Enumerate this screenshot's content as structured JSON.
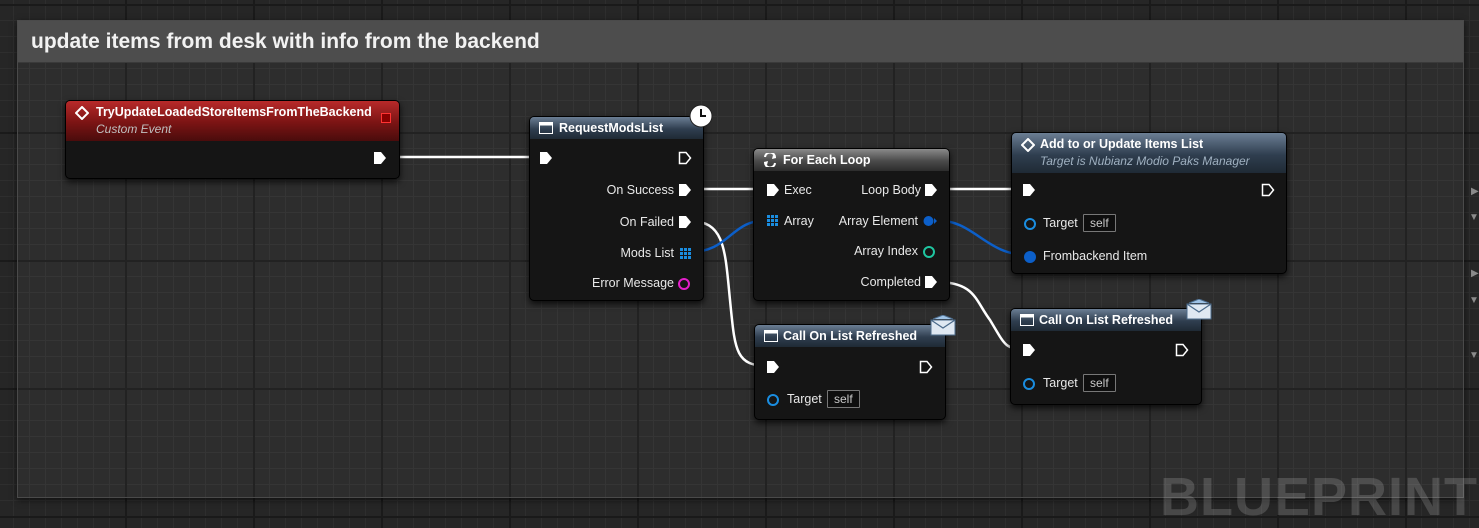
{
  "comment": {
    "title": "update items from desk with info from the backend"
  },
  "watermark": "BLUEPRINT",
  "event_node": {
    "title": "TryUpdateLoadedStoreItemsFromTheBackend",
    "subtitle": "Custom Event"
  },
  "request_node": {
    "title": "RequestModsList",
    "outputs": [
      "On Success",
      "On Failed",
      "Mods List",
      "Error Message"
    ]
  },
  "loop_node": {
    "title": "For Each Loop",
    "inputs": [
      "Exec",
      "Array"
    ],
    "outputs": [
      "Loop Body",
      "Array Element",
      "Array Index",
      "Completed"
    ]
  },
  "add_node": {
    "title": "Add to or Update Items List",
    "subtitle": "Target is Nubianz Modio Paks Manager",
    "inputs": [
      "Target",
      "Frombackend Item"
    ],
    "target_value": "self"
  },
  "refresh_node_a": {
    "title": "Call On List Refreshed",
    "inputs": [
      "Target"
    ],
    "target_value": "self"
  },
  "refresh_node_b": {
    "title": "Call On List Refreshed",
    "inputs": [
      "Target"
    ],
    "target_value": "self"
  },
  "colors": {
    "exec": "#ffffff",
    "object_ref": "#1a8de0",
    "array_elem": "#0c5fc9",
    "integer": "#1fc5a0",
    "string": "#e21fc9",
    "event_header": "#8c1a1a",
    "function_header": "#3a4d60"
  }
}
